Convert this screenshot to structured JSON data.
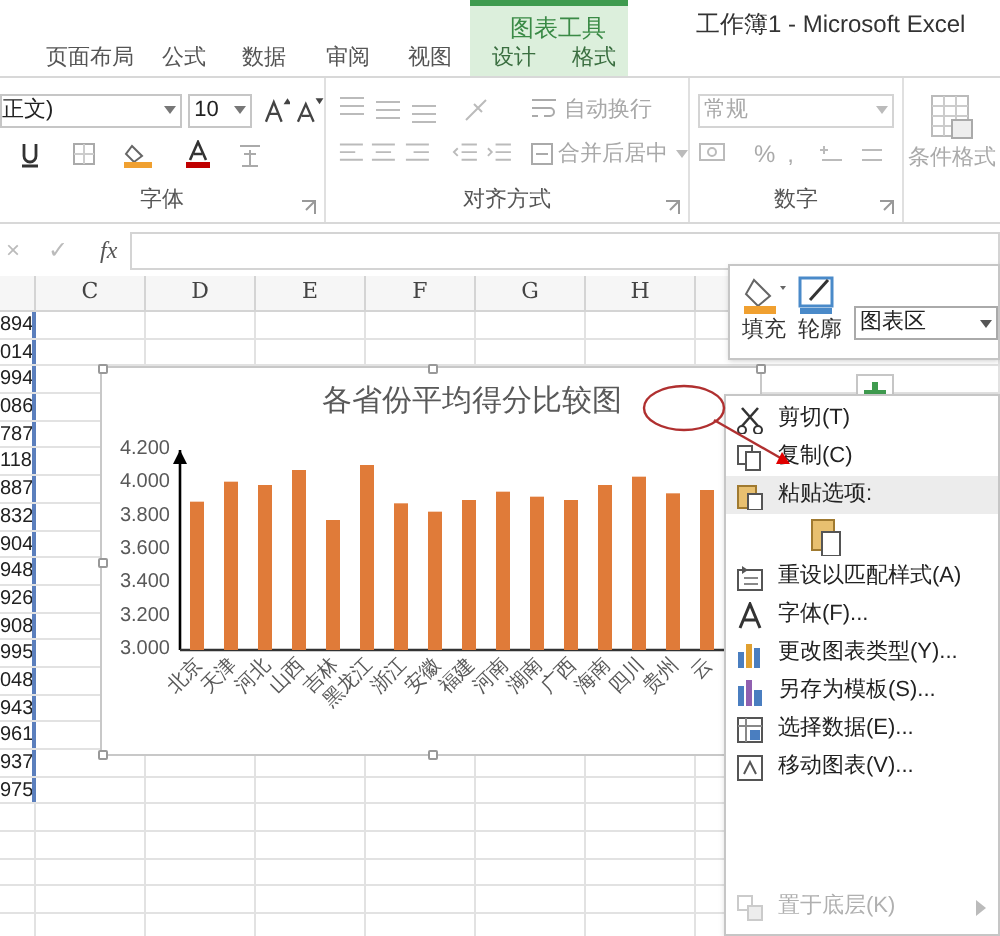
{
  "window": {
    "title": "工作簿1 - Microsoft Excel"
  },
  "contextual_group": {
    "label": "图表工具"
  },
  "tabs": [
    {
      "label": "页面布局",
      "contextual": false
    },
    {
      "label": "公式",
      "contextual": false
    },
    {
      "label": "数据",
      "contextual": false
    },
    {
      "label": "审阅",
      "contextual": false
    },
    {
      "label": "视图",
      "contextual": false
    },
    {
      "label": "设计",
      "contextual": true
    },
    {
      "label": "格式",
      "contextual": true
    }
  ],
  "ribbon": {
    "font_name": "正文)",
    "font_size": "10",
    "wrap_text": {
      "label": "自动换行",
      "disabled": true
    },
    "merge_center": {
      "label": "合并后居中",
      "disabled": true
    },
    "number_format": {
      "value": "常规",
      "disabled": true
    },
    "percent": "%",
    "comma": ",",
    "conditional_format": "条件格式",
    "groups": [
      "字体",
      "对齐方式",
      "数字"
    ]
  },
  "formula_bar": {
    "cancel": "×",
    "enter": "✓",
    "function": "fx"
  },
  "sheet": {
    "columns": [
      "C",
      "D",
      "E",
      "F",
      "G",
      "H"
    ],
    "column_b": [
      "894",
      "014",
      "994",
      "086",
      "787",
      "118",
      "887",
      "832",
      "904",
      "948",
      "926",
      "908",
      "995",
      "048",
      "943",
      "961",
      "937",
      "975"
    ]
  },
  "chart": {
    "title": "各省份平均得分比较图",
    "chart_data": {
      "type": "bar",
      "categories": [
        "北京",
        "天津",
        "河北",
        "山西",
        "吉林",
        "黑龙江",
        "浙江",
        "安徽",
        "福建",
        "河南",
        "湖南",
        "广西",
        "海南",
        "四川",
        "贵州",
        "云"
      ],
      "series": [
        {
          "color": "#e07b39",
          "values": [
            3.89,
            4.01,
            3.99,
            4.08,
            3.78,
            4.11,
            3.88,
            3.83,
            3.9,
            3.95,
            3.92,
            3.9,
            3.99,
            4.04,
            3.94,
            3.96
          ]
        }
      ],
      "ylim": [
        3,
        4.2
      ],
      "yticks": [
        {
          "value": 3,
          "label": "3.000"
        },
        {
          "value": 3.2,
          "label": "3.200"
        },
        {
          "value": 3.4,
          "label": "3.400"
        },
        {
          "value": 3.6,
          "label": "3.600"
        },
        {
          "value": 3.8,
          "label": "3.800"
        },
        {
          "value": 4,
          "label": "4.000"
        },
        {
          "value": 4.2,
          "label": "4.200"
        }
      ]
    }
  },
  "format_toolbar": {
    "fill": "填充",
    "outline": "轮廓",
    "chart_element": "图表区"
  },
  "context_menu": [
    {
      "kind": "cut",
      "label": "剪切(T)",
      "disabled": false,
      "submenu": false
    },
    {
      "kind": "copy",
      "label": "复制(C)",
      "disabled": false,
      "submenu": false
    },
    {
      "kind": "paste_header",
      "label": "粘贴选项:",
      "disabled": false,
      "submenu": false
    },
    {
      "kind": "paste_option",
      "disabled": false,
      "submenu": false
    },
    {
      "kind": "reset",
      "label": "重设以匹配样式(A)",
      "disabled": false,
      "submenu": false
    },
    {
      "kind": "font",
      "label": "字体(F)...",
      "disabled": false,
      "submenu": false
    },
    {
      "kind": "change_type",
      "label": "更改图表类型(Y)...",
      "disabled": false,
      "submenu": false
    },
    {
      "kind": "save_template",
      "label": "另存为模板(S)...",
      "disabled": false,
      "submenu": false
    },
    {
      "kind": "select_data",
      "label": "选择数据(E)...",
      "disabled": false,
      "submenu": false
    },
    {
      "kind": "move",
      "label": "移动图表(V)...",
      "disabled": false,
      "submenu": false
    },
    {
      "kind": "send_back",
      "label": "置于底层(K)",
      "disabled": true,
      "submenu": true
    }
  ]
}
